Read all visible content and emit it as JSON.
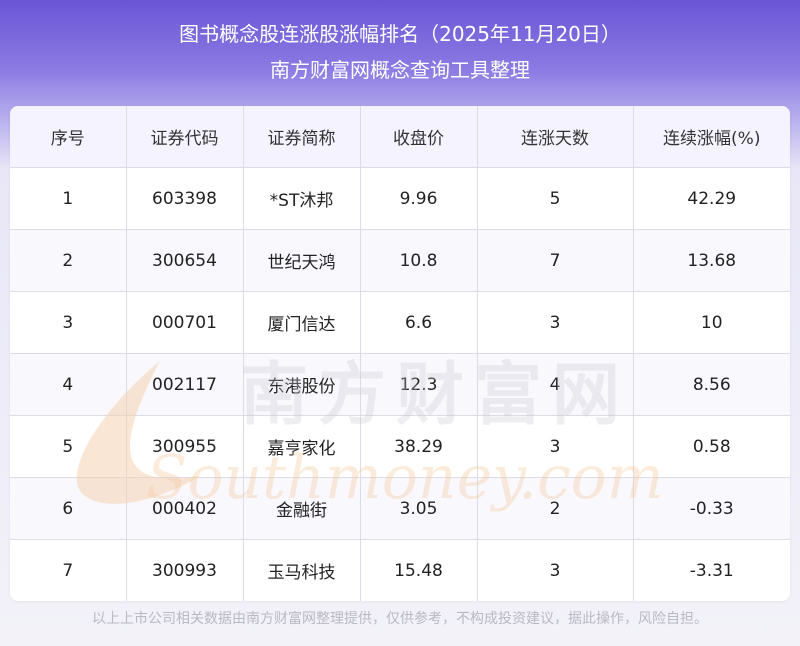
{
  "header": {
    "title_line1": "图书概念股连涨股涨幅排名（2025年11月20日）",
    "title_line2": "南方财富网概念查询工具整理"
  },
  "table": {
    "columns": [
      "序号",
      "证券代码",
      "证券简称",
      "收盘价",
      "连涨天数",
      "连续涨幅(%)"
    ],
    "rows": [
      [
        "1",
        "603398",
        "*ST沐邦",
        "9.96",
        "5",
        "42.29"
      ],
      [
        "2",
        "300654",
        "世纪天鸿",
        "10.8",
        "7",
        "13.68"
      ],
      [
        "3",
        "000701",
        "厦门信达",
        "6.6",
        "3",
        "10"
      ],
      [
        "4",
        "002117",
        "东港股份",
        "12.3",
        "4",
        "8.56"
      ],
      [
        "5",
        "300955",
        "嘉亨家化",
        "38.29",
        "3",
        "0.58"
      ],
      [
        "6",
        "000402",
        "金融街",
        "3.05",
        "2",
        "-0.33"
      ],
      [
        "7",
        "300993",
        "玉马科技",
        "15.48",
        "3",
        "-3.31"
      ]
    ]
  },
  "watermark": {
    "brand_cn": "南方财富网",
    "brand_en": "Southmoney.com",
    "color": "#f6c89a"
  },
  "footer": {
    "disclaimer": "以上上市公司相关数据由南方财富网整理提供，仅供参考，不构成投资建议，据此操作，风险自担。"
  }
}
